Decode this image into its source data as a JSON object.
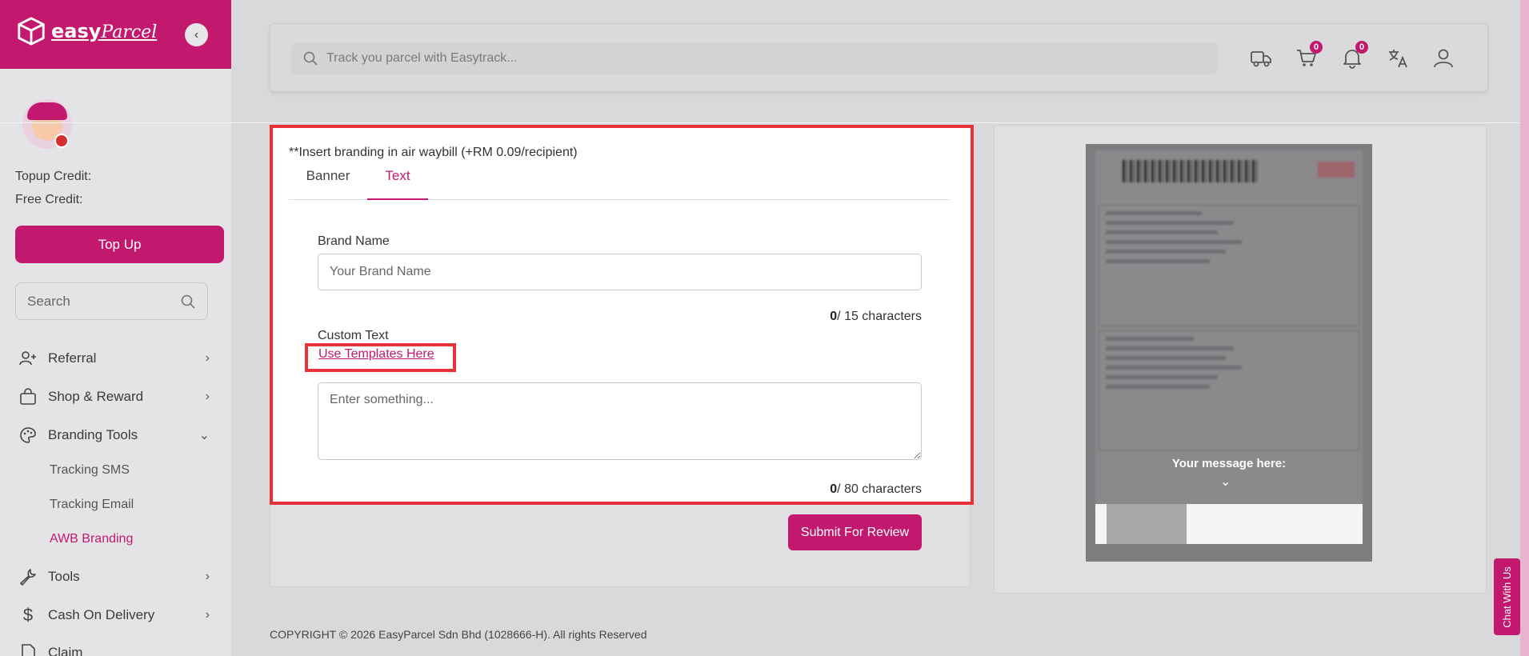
{
  "app": {
    "brand": "easy",
    "brand_script": "Parcel"
  },
  "sidebar": {
    "topup_credit_label": "Topup Credit:",
    "free_credit_label": "Free Credit:",
    "topup_button": "Top Up",
    "search_placeholder": "Search",
    "menu": [
      {
        "label": "Referral",
        "icon": "user-plus-icon"
      },
      {
        "label": "Shop & Reward",
        "icon": "shopping-bag-icon"
      },
      {
        "label": "Branding Tools",
        "icon": "palette-icon"
      },
      {
        "label": "Tools",
        "icon": "wrench-icon"
      },
      {
        "label": "Cash On Delivery",
        "icon": "dollar-icon"
      },
      {
        "label": "Claim",
        "icon": "document-icon"
      }
    ],
    "branding_sub": [
      "Tracking SMS",
      "Tracking Email",
      "AWB Branding"
    ]
  },
  "topbar": {
    "search_placeholder": "Track you parcel with Easytrack...",
    "cart_count": "0",
    "notification_count": "0"
  },
  "branding": {
    "note": "**Insert branding in air waybill (+RM 0.09/recipient)",
    "tabs": [
      "Banner",
      "Text"
    ],
    "active_tab": "Text",
    "brand_name_label": "Brand Name",
    "brand_name_placeholder": "Your Brand Name",
    "brand_name_count": "0",
    "brand_name_limit": "/ 15 characters",
    "custom_text_label": "Custom Text",
    "template_link": "Use Templates Here",
    "custom_text_placeholder": "Enter something...",
    "custom_text_count": "0",
    "custom_text_limit": "/ 80 characters",
    "submit_button": "Submit For Review"
  },
  "preview": {
    "message": "Your message here:"
  },
  "footer": {
    "copyright": "COPYRIGHT © 2026 EasyParcel Sdn Bhd (1028666-H). All rights Reserved"
  },
  "chat": {
    "label": "Chat With Us"
  },
  "colors": {
    "brand": "#c2196f",
    "highlight": "#e8323a"
  }
}
